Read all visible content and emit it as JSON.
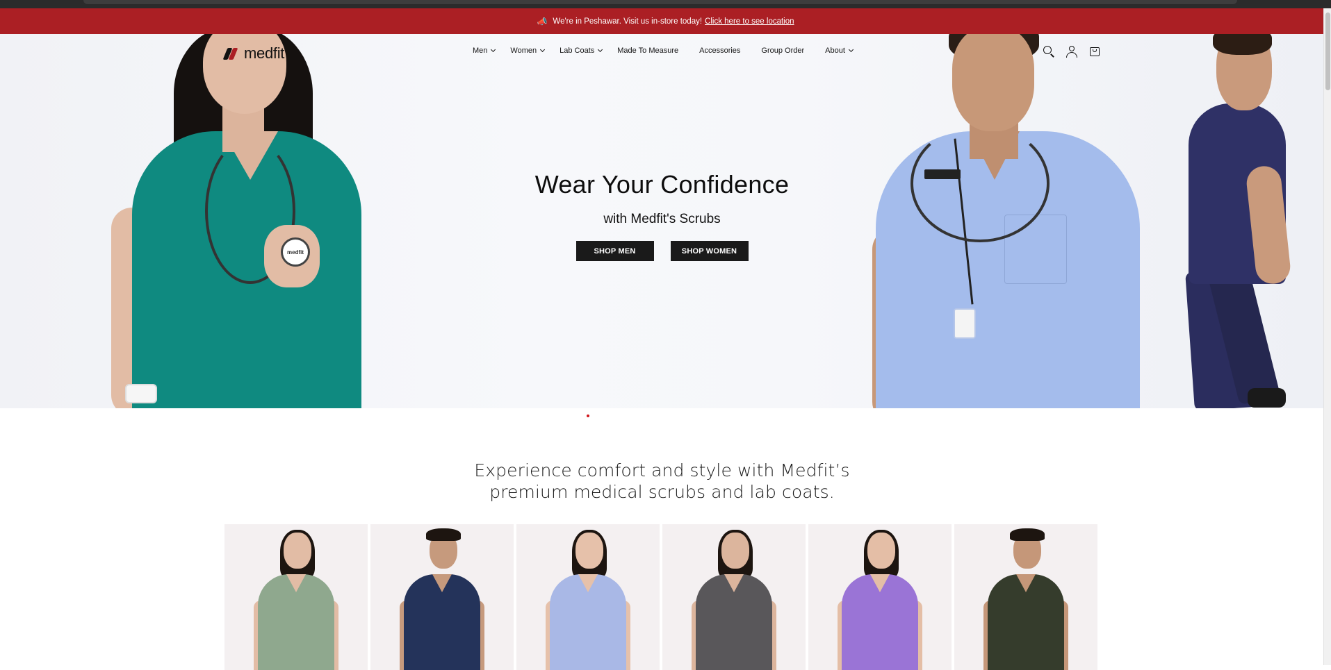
{
  "announcement": {
    "icon": "megaphone-icon",
    "text": "We're in Peshawar. Visit us in-store today!",
    "link_text": "Click here to see location",
    "background": "#ab1f24"
  },
  "header": {
    "logo_text": "medfit",
    "nav": [
      {
        "label": "Men",
        "dropdown": true
      },
      {
        "label": "Women",
        "dropdown": true
      },
      {
        "label": "Lab Coats",
        "dropdown": true
      },
      {
        "label": "Made To Measure",
        "dropdown": false
      },
      {
        "label": "Accessories",
        "dropdown": false
      },
      {
        "label": "Group Order",
        "dropdown": false
      },
      {
        "label": "About",
        "dropdown": true
      }
    ],
    "icons": [
      "search-icon",
      "account-icon",
      "cart-icon"
    ]
  },
  "hero": {
    "title": "Wear Your Confidence",
    "subtitle": "with Medfit's Scrubs",
    "buttons": [
      "SHOP MEN",
      "SHOP WOMEN"
    ],
    "badge_text": "medfit",
    "slide_dots_active": 1
  },
  "intro": {
    "line1": "Experience comfort and style with Medfit’s",
    "line2": "premium medical scrubs and lab coats."
  },
  "products": [
    {
      "color": "#8fa88e",
      "skin": "#e2bca5",
      "hair": true
    },
    {
      "color": "#24335a",
      "skin": "#c69a7d",
      "hair": false
    },
    {
      "color": "#a9b8e6",
      "skin": "#e6c1aa",
      "hair": true
    },
    {
      "color": "#59575a",
      "skin": "#dcb59d",
      "hair": true
    },
    {
      "color": "#9a74d6",
      "skin": "#e4bea6",
      "hair": true
    },
    {
      "color": "#353c2c",
      "skin": "#c59779",
      "hair": false
    }
  ],
  "colors": {
    "accent": "#ab1f24",
    "button": "#1a1a1a"
  }
}
